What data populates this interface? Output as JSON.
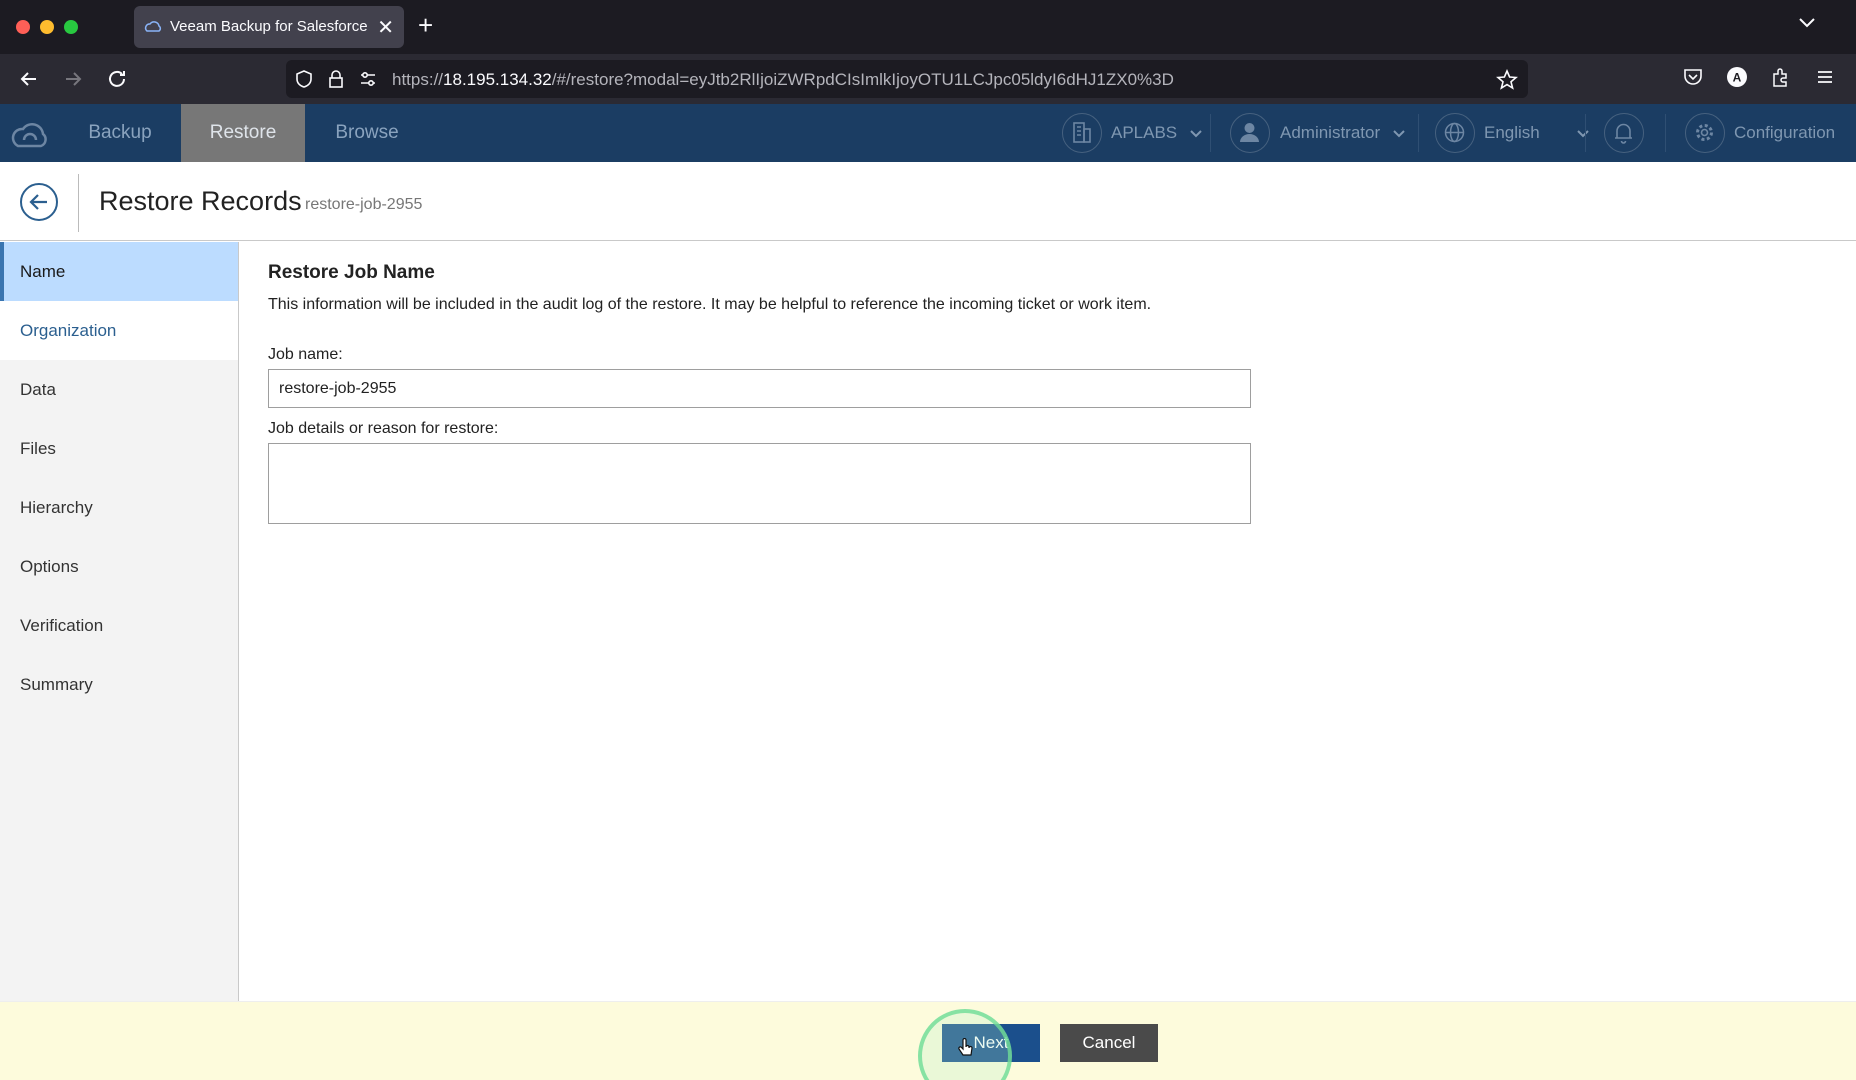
{
  "browser": {
    "tab_title": "Veeam Backup for Salesforce",
    "tab_close": "✕",
    "new_tab": "+",
    "url_prefix": "https://",
    "url_host": "18.195.134.32",
    "url_path": "/#/restore?modal=eyJtb2RlIjoiZWRpdCIsImlkIjoyOTU1LCJpc05ldyI6dHJ1ZX0%3D"
  },
  "app_header": {
    "nav": [
      "Backup",
      "Restore",
      "Browse"
    ],
    "active_nav": "Restore",
    "org": "APLABS",
    "user": "Administrator",
    "language": "English",
    "configuration": "Configuration"
  },
  "page": {
    "title": "Restore Records",
    "subtitle": "restore-job-2955"
  },
  "sidebar": {
    "items": [
      "Name",
      "Organization",
      "Data",
      "Files",
      "Hierarchy",
      "Options",
      "Verification",
      "Summary"
    ],
    "active": "Name"
  },
  "form": {
    "section_title": "Restore Job Name",
    "description": "This information will be included in the audit log of the restore. It may be helpful to reference the incoming ticket or work item.",
    "job_name_label": "Job name:",
    "job_name_value": "restore-job-2955",
    "details_label": "Job details or reason for restore:",
    "details_value": ""
  },
  "footer": {
    "next_label": "Next",
    "cancel_label": "Cancel"
  },
  "colors": {
    "header_bg": "#1b3d63",
    "active_nav_bg": "#777777",
    "sidebar_active_bg": "#bcdcff",
    "next_button": "#1b4f8c",
    "cancel_button": "#4a4a4a",
    "footer_bg": "#fdfbdc"
  }
}
